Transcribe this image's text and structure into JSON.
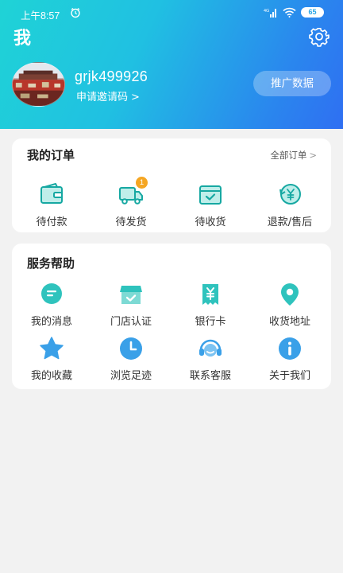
{
  "status_bar": {
    "time": "上午8:57",
    "network": "4G",
    "battery": "65"
  },
  "page": {
    "title": "我"
  },
  "profile": {
    "username": "grjk499926",
    "invite_label": "申请邀请码",
    "invite_chevron": ">",
    "promo_button": "推广数据"
  },
  "orders": {
    "title": "我的订单",
    "all_label": "全部订单",
    "all_chevron": ">",
    "items": [
      {
        "label": "待付款",
        "icon": "wallet-icon"
      },
      {
        "label": "待发货",
        "icon": "truck-icon",
        "badge": "1"
      },
      {
        "label": "待收货",
        "icon": "package-icon"
      },
      {
        "label": "退款/售后",
        "icon": "refund-icon"
      }
    ]
  },
  "services": {
    "title": "服务帮助",
    "items": [
      {
        "label": "我的消息",
        "icon": "message-icon"
      },
      {
        "label": "门店认证",
        "icon": "store-icon"
      },
      {
        "label": "银行卡",
        "icon": "bank-card-icon"
      },
      {
        "label": "收货地址",
        "icon": "location-pin-icon"
      },
      {
        "label": "我的收藏",
        "icon": "star-icon"
      },
      {
        "label": "浏览足迹",
        "icon": "clock-icon"
      },
      {
        "label": "联系客服",
        "icon": "headset-icon"
      },
      {
        "label": "关于我们",
        "icon": "info-icon"
      }
    ]
  },
  "colors": {
    "header_gradient_start": "#1fd3d6",
    "header_gradient_end": "#2f6ff2",
    "icon_teal": "#16b7b2",
    "icon_blue": "#3aa0e8",
    "badge": "#f5a623"
  }
}
